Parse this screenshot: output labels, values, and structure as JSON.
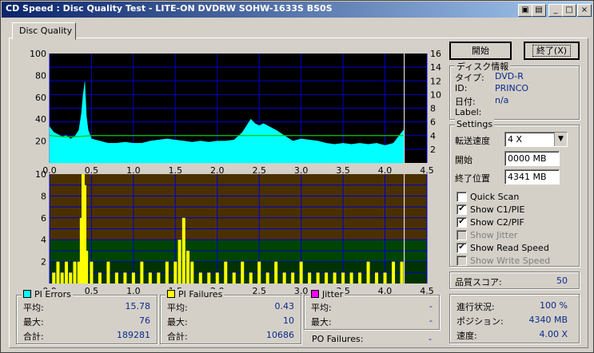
{
  "window": {
    "title": "CD Speed : Disc Quality Test - LITE-ON DVDRW SOHW-1633S BS0S"
  },
  "tab": {
    "label": "Disc Quality"
  },
  "buttons": {
    "start": "開始",
    "stop": "終了(X)"
  },
  "disc_info": {
    "title": "ディスク情報",
    "rows": [
      {
        "label": "タイプ:",
        "value": "DVD-R"
      },
      {
        "label": "ID:",
        "value": "PRINCO"
      },
      {
        "label": "日付:",
        "value": "n/a"
      },
      {
        "label": "Label:",
        "value": ""
      }
    ]
  },
  "settings": {
    "title": "Settings",
    "speed_label": "転送速度",
    "speed_value": "4 X",
    "start_label": "開始",
    "start_value": "0000 MB",
    "end_label": "終了位置",
    "end_value": "4341 MB",
    "checks": [
      {
        "label": "Quick Scan",
        "checked": false,
        "enabled": true
      },
      {
        "label": "Show C1/PIE",
        "checked": true,
        "enabled": true
      },
      {
        "label": "Show C2/PIF",
        "checked": true,
        "enabled": true
      },
      {
        "label": "Show Jitter",
        "checked": false,
        "enabled": false
      },
      {
        "label": "Show Read Speed",
        "checked": true,
        "enabled": true
      },
      {
        "label": "Show Write Speed",
        "checked": false,
        "enabled": false
      }
    ]
  },
  "score": {
    "label": "品質スコア:",
    "value": "50"
  },
  "progress": {
    "rows": [
      {
        "label": "進行状況:",
        "value": "100 %"
      },
      {
        "label": "ポジション:",
        "value": "4340 MB"
      },
      {
        "label": "速度:",
        "value": "4.00 X"
      }
    ]
  },
  "pi_errors": {
    "title": "PI Errors",
    "color": "#00ffff",
    "rows": [
      {
        "label": "平均:",
        "value": "15.78"
      },
      {
        "label": "最大:",
        "value": "76"
      },
      {
        "label": "合計:",
        "value": "189281"
      }
    ]
  },
  "pi_failures": {
    "title": "PI Failures",
    "color": "#ffff00",
    "rows": [
      {
        "label": "平均:",
        "value": "0.43"
      },
      {
        "label": "最大:",
        "value": "10"
      },
      {
        "label": "合計:",
        "value": "10686"
      }
    ]
  },
  "jitter": {
    "title": "Jitter",
    "color": "#ff00ff",
    "rows": [
      {
        "label": "平均:",
        "value": "-"
      },
      {
        "label": "最大:",
        "value": "-"
      }
    ],
    "po_label": "PO Failures:",
    "po_value": "-"
  },
  "chart_data": [
    {
      "type": "area",
      "x_ticks": [
        "0.0",
        "0.5",
        "1.0",
        "1.5",
        "2.0",
        "2.5",
        "3.0",
        "3.5",
        "4.0",
        "4.5"
      ],
      "y_left_ticks": [
        "100",
        "80",
        "60",
        "40",
        "20"
      ],
      "y_right_ticks": [
        "16",
        "14",
        "12",
        "10",
        "8",
        "6",
        "4",
        "2"
      ],
      "xlim": [
        0,
        4.5
      ],
      "ylim": [
        0,
        100
      ],
      "y2lim": [
        0,
        16
      ],
      "series": [
        {
          "x": [
            0,
            0.05,
            0.1,
            0.15,
            0.2,
            0.25,
            0.3,
            0.35,
            0.38,
            0.4,
            0.42,
            0.44,
            0.46,
            0.5,
            0.6,
            0.7,
            0.8,
            0.9,
            1.0,
            1.1,
            1.2,
            1.3,
            1.4,
            1.5,
            1.6,
            1.7,
            1.8,
            1.9,
            2.0,
            2.1,
            2.2,
            2.3,
            2.35,
            2.4,
            2.45,
            2.5,
            2.55,
            2.6,
            2.65,
            2.7,
            2.8,
            2.9,
            3.0,
            3.1,
            3.2,
            3.3,
            3.4,
            3.5,
            3.6,
            3.7,
            3.8,
            3.9,
            4.0,
            4.1,
            4.2,
            4.22
          ],
          "values": [
            33,
            28,
            26,
            24,
            25,
            22,
            24,
            30,
            45,
            62,
            74,
            42,
            30,
            22,
            20,
            18,
            18,
            19,
            18,
            18,
            20,
            21,
            22,
            21,
            20,
            19,
            20,
            19,
            20,
            20,
            21,
            28,
            34,
            40,
            36,
            34,
            36,
            34,
            32,
            30,
            25,
            20,
            22,
            21,
            20,
            18,
            17,
            18,
            17,
            18,
            17,
            18,
            16,
            18,
            28,
            30
          ]
        },
        {
          "x": [
            0,
            0.2,
            0.4,
            0.5,
            1.0,
            1.5,
            2.0,
            2.5,
            3.0,
            3.5,
            4.0,
            4.22
          ],
          "values": [
            4.0,
            3.8,
            3.9,
            4.0,
            4.0,
            4.0,
            4.0,
            4.0,
            4.0,
            4.0,
            4.0,
            4.0
          ]
        }
      ]
    },
    {
      "type": "bar",
      "x_ticks": [
        "0.0",
        "0.5",
        "1.0",
        "1.5",
        "2.0",
        "2.5",
        "3.0",
        "3.5",
        "4.0",
        "4.5"
      ],
      "y_ticks": [
        "10",
        "8",
        "6",
        "4",
        "2"
      ],
      "xlim": [
        0,
        4.5
      ],
      "ylim": [
        0,
        10
      ],
      "series": [
        {
          "x": [
            0.05,
            0.1,
            0.15,
            0.2,
            0.25,
            0.3,
            0.35,
            0.38,
            0.4,
            0.42,
            0.44,
            0.5,
            0.6,
            0.7,
            0.8,
            0.9,
            1.0,
            1.1,
            1.2,
            1.3,
            1.4,
            1.5,
            1.55,
            1.6,
            1.65,
            1.7,
            1.8,
            1.9,
            2.0,
            2.1,
            2.2,
            2.3,
            2.4,
            2.5,
            2.6,
            2.7,
            2.8,
            2.9,
            3.0,
            3.1,
            3.2,
            3.3,
            3.4,
            3.5,
            3.6,
            3.7,
            3.8,
            3.9,
            4.0,
            4.1,
            4.2
          ],
          "values": [
            1,
            2,
            1,
            2,
            1,
            2,
            2,
            6,
            10,
            9,
            3,
            2,
            1,
            2,
            1,
            1,
            1,
            2,
            1,
            1,
            2,
            2,
            4,
            6,
            3,
            2,
            1,
            1,
            1,
            2,
            1,
            2,
            1,
            2,
            1,
            2,
            1,
            1,
            2,
            1,
            1,
            1,
            1,
            1,
            1,
            1,
            2,
            1,
            1,
            2,
            2
          ]
        }
      ]
    }
  ]
}
